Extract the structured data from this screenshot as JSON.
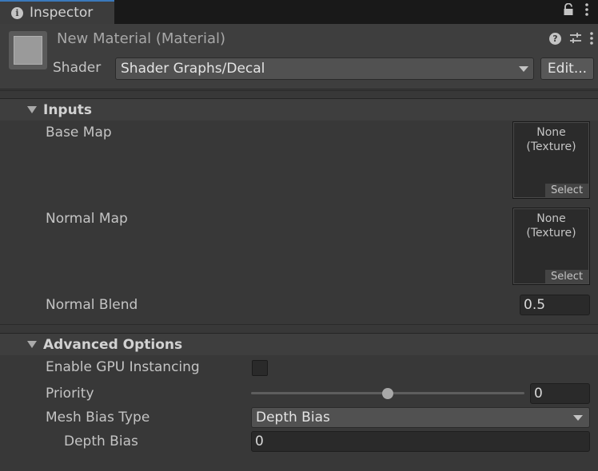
{
  "tab": {
    "label": "Inspector"
  },
  "header": {
    "title": "New Material (Material)",
    "shader_label": "Shader",
    "shader_value": "Shader Graphs/Decal",
    "edit_label": "Edit..."
  },
  "inputs": {
    "title": "Inputs",
    "base_map": {
      "label": "Base Map",
      "slot_text": "None\n(Texture)",
      "select": "Select"
    },
    "normal_map": {
      "label": "Normal Map",
      "slot_text": "None\n(Texture)",
      "select": "Select"
    },
    "normal_blend": {
      "label": "Normal Blend",
      "value": "0.5"
    }
  },
  "advanced": {
    "title": "Advanced Options",
    "gpu_instancing": {
      "label": "Enable GPU Instancing",
      "checked": false
    },
    "priority": {
      "label": "Priority",
      "value": "0",
      "slider_fraction": 0.5
    },
    "mesh_bias_type": {
      "label": "Mesh Bias Type",
      "value": "Depth Bias"
    },
    "depth_bias": {
      "label": "Depth Bias",
      "value": "0"
    }
  },
  "colors": {
    "accent": "#3a79bb",
    "background": "#383838"
  }
}
